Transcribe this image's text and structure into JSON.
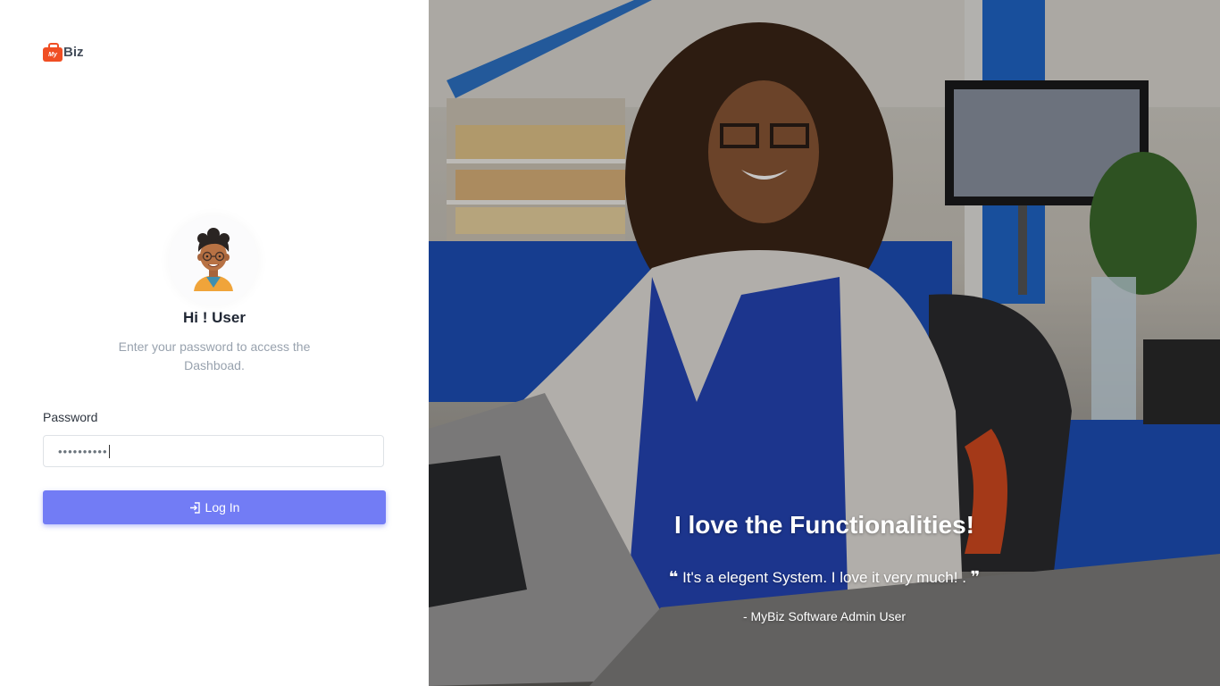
{
  "brand": {
    "logo_mark": "My",
    "name": "Biz"
  },
  "login": {
    "title": "Hi ! User",
    "subtitle": "Enter your password to access the Dashboad.",
    "password_label": "Password",
    "password_value": "••••••••••",
    "button_label": "Log In",
    "button_icon": "login-icon",
    "accent_color": "#727cf5"
  },
  "testimonial": {
    "headline": "I love the Functionalities!",
    "quote": "It's a elegent System. I love it very much! .",
    "open_quote": "❝",
    "close_quote": "❞",
    "author": "- MyBiz Software Admin User"
  }
}
